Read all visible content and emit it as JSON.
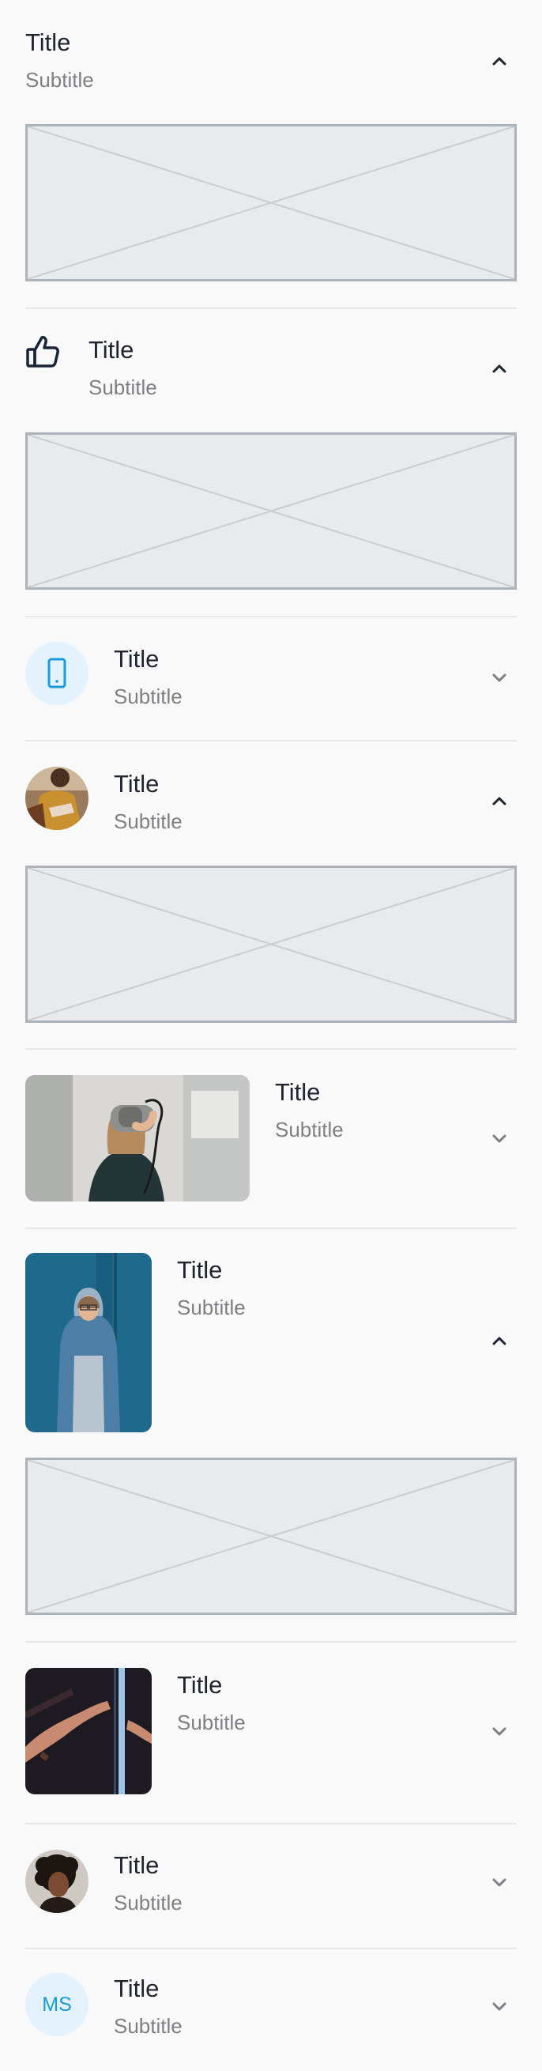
{
  "items": [
    {
      "title": "Title",
      "subtitle": "Subtitle",
      "expanded": true,
      "leading": "none"
    },
    {
      "title": "Title",
      "subtitle": "Subtitle",
      "expanded": true,
      "leading": "thumbs-up-icon"
    },
    {
      "title": "Title",
      "subtitle": "Subtitle",
      "expanded": false,
      "leading": "phone-icon"
    },
    {
      "title": "Title",
      "subtitle": "Subtitle",
      "expanded": true,
      "leading": "round-avatar-photo"
    },
    {
      "title": "Title",
      "subtitle": "Subtitle",
      "expanded": false,
      "leading": "wide-photo-vr-headset"
    },
    {
      "title": "Title",
      "subtitle": "Subtitle",
      "expanded": true,
      "leading": "tall-photo-hooded-person"
    },
    {
      "title": "Title",
      "subtitle": "Subtitle",
      "expanded": false,
      "leading": "square-photo-hands"
    },
    {
      "title": "Title",
      "subtitle": "Subtitle",
      "expanded": false,
      "leading": "round-avatar-portrait"
    },
    {
      "title": "Title",
      "subtitle": "Subtitle",
      "expanded": false,
      "leading": "initials-avatar",
      "initials": "MS"
    }
  ],
  "colors": {
    "accent": "#1a9ad6",
    "accent_tint": "#e3f2fc",
    "icon_dark": "#182438",
    "divider": "#e5e7ea",
    "placeholder_fill": "#e8ebec",
    "placeholder_border": "#adb4b9"
  }
}
